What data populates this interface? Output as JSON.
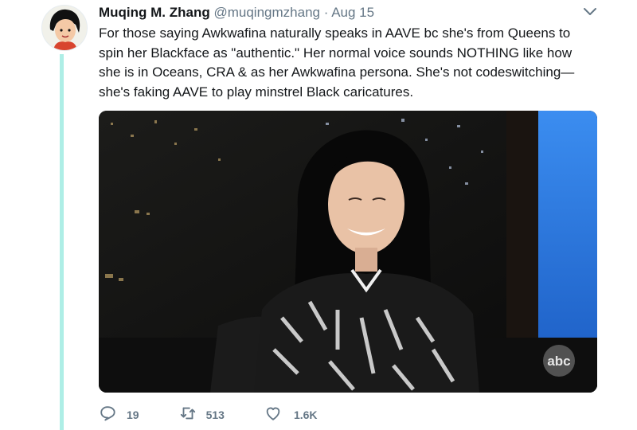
{
  "tweet": {
    "author_name": "Muqing M. Zhang",
    "handle": "@muqingmzhang",
    "separator": "·",
    "date": "Aug 15",
    "text": "For those saying Awkwafina naturally speaks in AAVE bc she's from Queens to spin her Blackface as \"authentic.\" Her normal voice sounds NOTHING like how she is in Oceans, CRA & as her Awkwafina persona. She's not codeswitching—she's faking AAVE to play minstrel Black caricatures.",
    "media": {
      "watermark": "abc"
    },
    "actions": {
      "replies": "19",
      "retweets": "513",
      "likes": "1.6K"
    }
  },
  "icons": {
    "more": "chevron-down-icon",
    "reply": "reply-icon",
    "retweet": "retweet-icon",
    "like": "heart-icon"
  },
  "colors": {
    "thread_line": "#aeeee6",
    "secondary_text": "#657786",
    "primary_text": "#14171a",
    "tv_screen_blue": "#2f7dea"
  }
}
